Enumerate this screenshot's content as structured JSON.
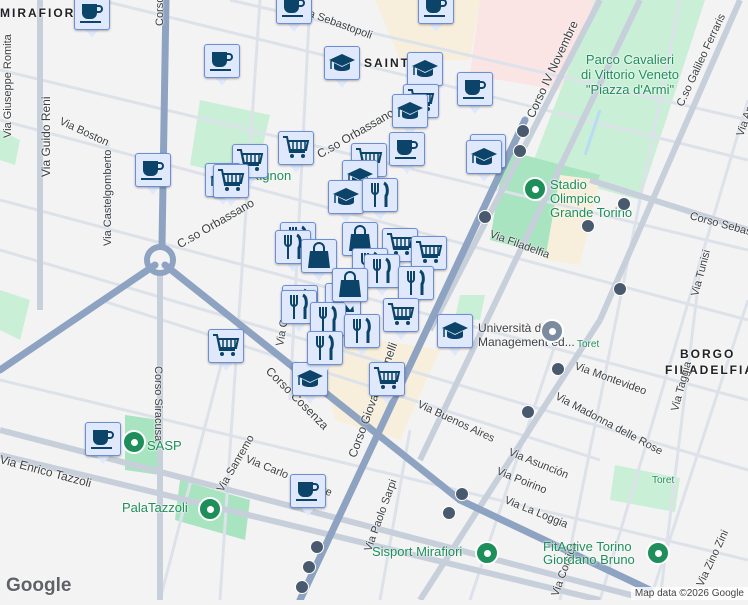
{
  "map": {
    "areas": [
      "MIRAFIORI",
      "SAINT",
      "BORGO",
      "FILADELFIA"
    ],
    "streets": [
      "Via Giuseppe Romita",
      "Corso Siracusa",
      "Via Guido Reni",
      "Via Boston",
      "Via Castelgomberto",
      "C.so Orbassano",
      "C.so Orbassano",
      "Corso Siracusa",
      "Via Sebastopoli",
      "Corso IV Novembre",
      "C.so Galileo Ferraris",
      "Via Filadelfia",
      "Corso Sebastopoli",
      "Via Tunisi",
      "Via Montevideo",
      "Via Madonna delle Rose",
      "Via Taggia",
      "Via Buenos Aires",
      "Via Asunción",
      "Via Poirino",
      "Via La Loggia",
      "Via Paolo Sarpi",
      "Via Zino Zini",
      "Corso Giovanni Agnelli",
      "Corso Cosenza",
      "Via Sanremo",
      "Via Carlo del Prete",
      "Via Enrico Tazzoli",
      "Via Gorizia",
      "Via Corsica",
      "Via Amati"
    ],
    "pois": [
      "Parco Cavalieri di Vittorio Veneto \"Piazza d'Armi\"",
      "Stadio Olimpico Grande Torino",
      "Università di Management ed...",
      "SASP",
      "PalaTazzoli",
      "Sisport Mirafiori",
      "FitActive Torino Giordano Bruno",
      "Toret",
      "Toret",
      "Rignon"
    ],
    "markers": [
      "coffee",
      "coffee",
      "coffee",
      "coffee",
      "graduation-cap",
      "graduation-cap",
      "cart",
      "graduation-cap",
      "coffee",
      "coffee",
      "graduation-cap",
      "graduation-cap",
      "cart",
      "cart",
      "graduation-cap",
      "cart",
      "coffee",
      "cart",
      "graduation-cap",
      "graduation-cap",
      "fork-knife",
      "fork-knife",
      "fork-knife",
      "bag",
      "bag",
      "cart",
      "fork-knife",
      "fork-knife",
      "cart",
      "bag",
      "fork-knife",
      "fork-knife",
      "fork-knife",
      "cart",
      "fork-knife",
      "fork-knife",
      "graduation-cap",
      "cart",
      "graduation-cap",
      "cart",
      "coffee",
      "coffee",
      "fork-knife",
      "bag"
    ],
    "logo": "Google",
    "attribution": "Map data ©2026 Google"
  },
  "colors": {
    "marker_bg": "#dfe9fb",
    "marker_icon": "#0b4468",
    "park": "#c9efd7",
    "poi": "#1e8e5a"
  }
}
